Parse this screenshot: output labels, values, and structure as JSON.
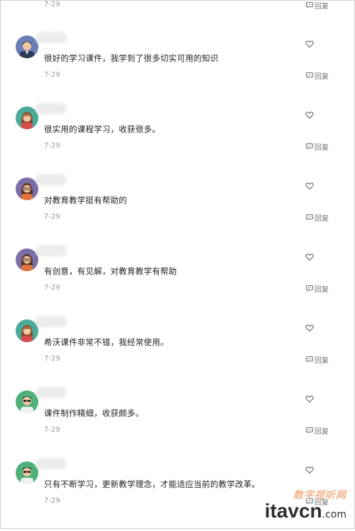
{
  "reply_label": "回复",
  "top_partial": {
    "date": "7-29"
  },
  "comments": [
    {
      "text": "很好的学习课件，我学到了很多切实可用的知识",
      "date": "7-29",
      "avatar": "man-avatar"
    },
    {
      "text": "很实用的课程学习，收获很多。",
      "date": "7-29",
      "avatar": "woman-avatar"
    },
    {
      "text": "对教育教学挺有帮助的",
      "date": "7-29",
      "avatar": "woman-glasses-avatar"
    },
    {
      "text": "有创意，有见解，对教育教学有帮助",
      "date": "7-29",
      "avatar": "woman-glasses-avatar"
    },
    {
      "text": "希沃课件非常不错，我经常使用。",
      "date": "7-29",
      "avatar": "woman-avatar"
    },
    {
      "text": "课件制作精细，收获颇多。",
      "date": "7-29",
      "avatar": "man-sunglasses-avatar"
    },
    {
      "text": "只有不断学习，更新教学理念，才能适应当前的教学改革。",
      "date": "7-29",
      "avatar": "man-sunglasses-avatar"
    }
  ],
  "watermark": {
    "cn": "数字视听网",
    "en": "itavcn",
    "com": ".com"
  },
  "colors": {
    "text": "#222222",
    "date": "#9a9a9a",
    "icon": "#6f6f6f"
  }
}
